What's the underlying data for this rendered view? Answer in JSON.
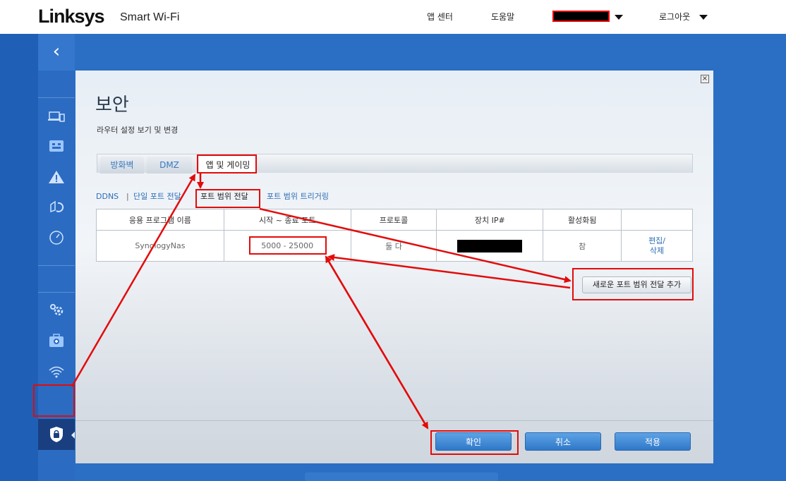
{
  "header": {
    "brand": "Linksys",
    "product": "Smart Wi-Fi",
    "nav": {
      "app_center": "앱 센터",
      "help": "도움말",
      "logout": "로그아웃"
    }
  },
  "sidebar": {
    "back_icon": "chevron-left-icon",
    "items": [
      {
        "name": "device-list-icon"
      },
      {
        "name": "network-map-icon"
      },
      {
        "name": "alert-icon"
      },
      {
        "name": "parental-controls-icon"
      },
      {
        "name": "speed-test-icon"
      },
      {
        "name": "router-settings-icon"
      },
      {
        "name": "troubleshooting-icon"
      },
      {
        "name": "wifi-settings-icon"
      },
      {
        "name": "security-icon",
        "active": true
      }
    ]
  },
  "panel": {
    "title": "보안",
    "subtitle": "라우터 설정 보기 및 변경",
    "tabs": [
      "방화벽",
      "DMZ",
      "앱 및 게이밍"
    ],
    "active_tab": "앱 및 게이밍",
    "subnav": [
      "DDNS",
      "단일 포트 전달",
      "포트 범위 전달",
      "포트 범위 트리거링"
    ],
    "active_subnav": "포트 범위 전달",
    "table": {
      "headers": [
        "응용 프로그램 이름",
        "시작 ~ 종료 포트",
        "프로토콜",
        "장치 IP#",
        "활성화됨",
        ""
      ],
      "rows": [
        {
          "app": "SynologyNas",
          "ports": "5000 - 25000",
          "protocol": "둘 다",
          "ip": "",
          "enabled": "참",
          "edit": "편집/",
          "delete": "삭제"
        }
      ]
    },
    "add_button": "새로운 포트 범위 전달 추가",
    "buttons": {
      "ok": "확인",
      "cancel": "취소",
      "apply": "적용"
    }
  },
  "colors": {
    "annotation": "#e30b0b",
    "accent": "#2d6cb5",
    "background": "#2a6fc4"
  }
}
